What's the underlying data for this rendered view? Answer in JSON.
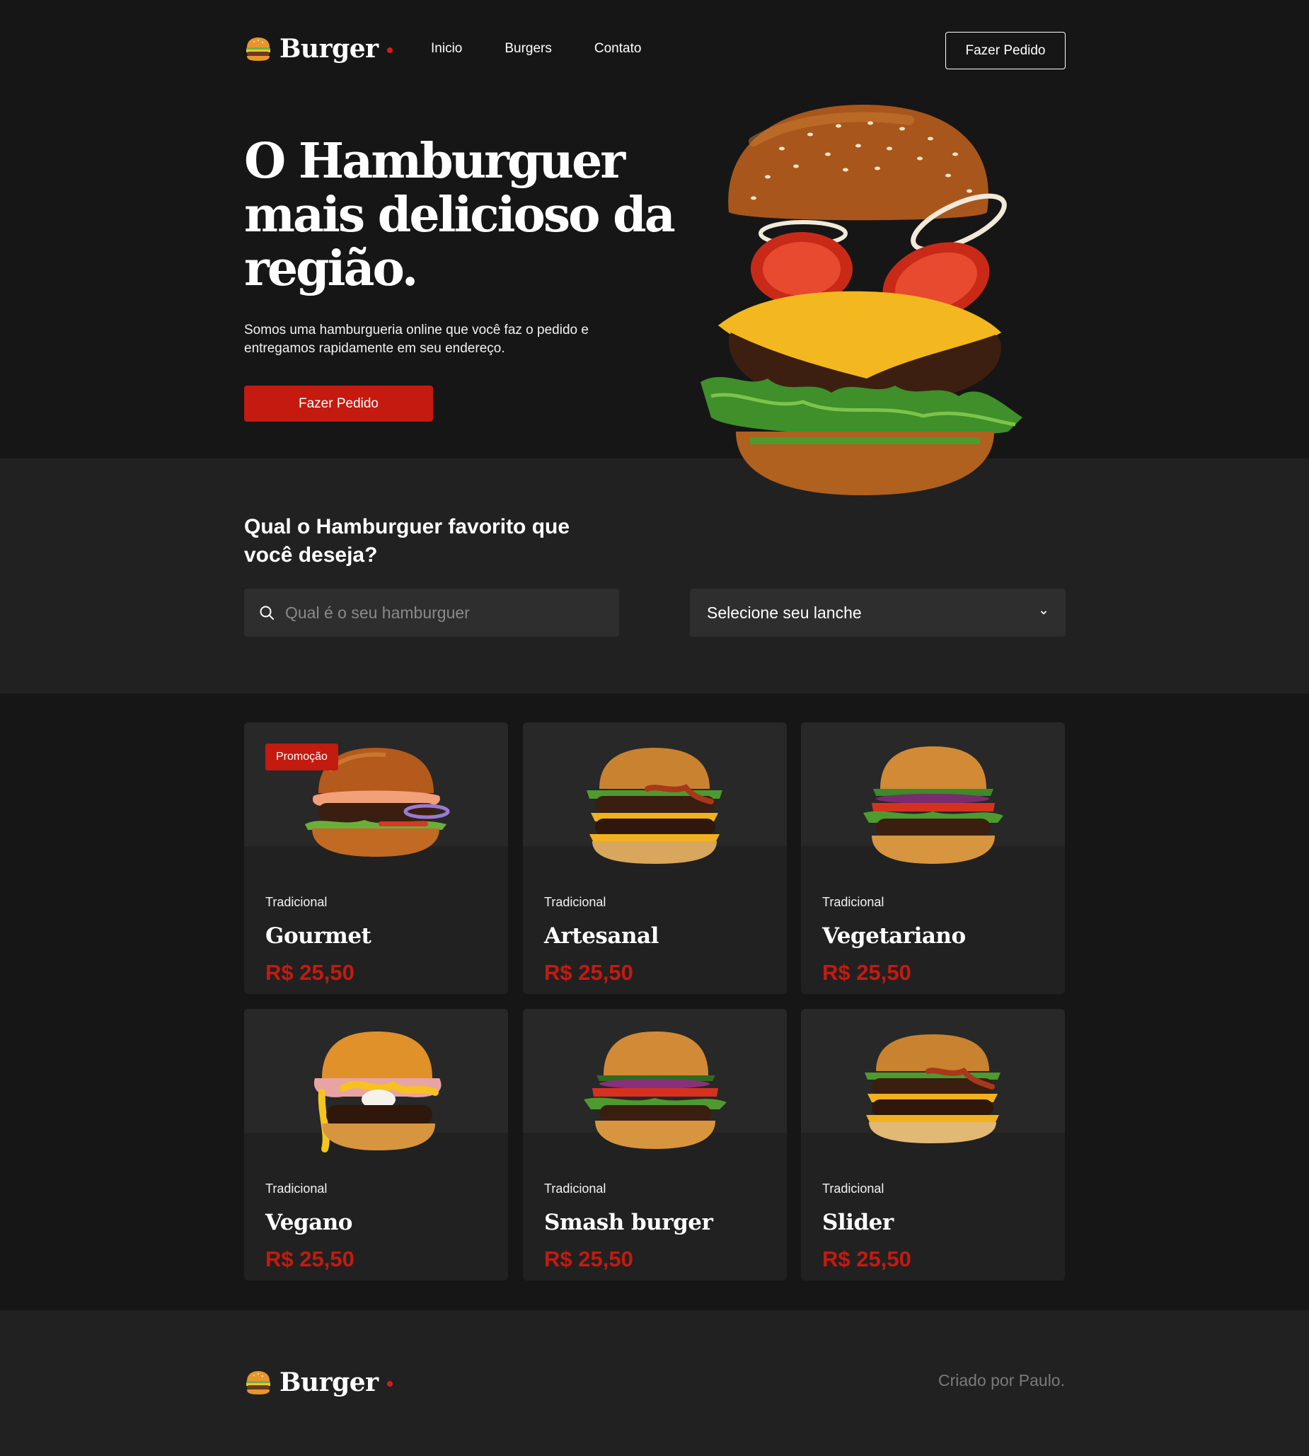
{
  "brand": {
    "name": "Burger",
    "icon": "hamburger-icon",
    "accent": "#c41a0f"
  },
  "nav": {
    "items": [
      "Inicio",
      "Burgers",
      "Contato"
    ]
  },
  "header": {
    "cta_label": "Fazer Pedido"
  },
  "hero": {
    "title": "O Hamburguer mais delicioso da região.",
    "description": "Somos uma hamburgueria online que você faz o pedido e entregamos rapidamente em seu endereço.",
    "cta_label": "Fazer Pedido"
  },
  "search": {
    "question": "Qual o Hamburguer favorito que você deseja?",
    "placeholder": "Qual é o seu hamburguer",
    "select_value": "Selecione seu lanche"
  },
  "products": [
    {
      "badge": "Promoção",
      "category": "Tradicional",
      "name": "Gourmet",
      "price": "R$ 25,50"
    },
    {
      "badge": "",
      "category": "Tradicional",
      "name": "Artesanal",
      "price": "R$ 25,50"
    },
    {
      "badge": "",
      "category": "Tradicional",
      "name": "Vegetariano",
      "price": "R$ 25,50"
    },
    {
      "badge": "",
      "category": "Tradicional",
      "name": "Vegano",
      "price": "R$ 25,50"
    },
    {
      "badge": "",
      "category": "Tradicional",
      "name": "Smash burger",
      "price": "R$ 25,50"
    },
    {
      "badge": "",
      "category": "Tradicional",
      "name": "Slider",
      "price": "R$ 25,50"
    }
  ],
  "footer": {
    "credit": "Criado por Paulo."
  }
}
